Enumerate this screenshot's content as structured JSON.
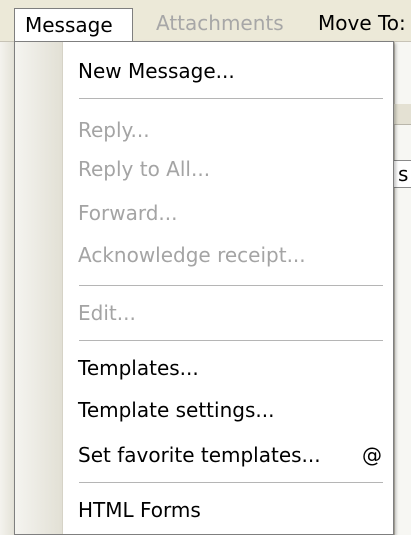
{
  "menubar": {
    "items": [
      {
        "label": "Message",
        "state": "open"
      },
      {
        "label": "Attachments",
        "state": "disabled"
      },
      {
        "label": "Move To:",
        "state": "normal"
      }
    ]
  },
  "background": {
    "field_text": "s"
  },
  "menu": {
    "items": [
      {
        "label": "New Message...",
        "enabled": true
      },
      {
        "label": "Reply...",
        "enabled": false
      },
      {
        "label": "Reply to All...",
        "enabled": false
      },
      {
        "label": "Forward...",
        "enabled": false
      },
      {
        "label": "Acknowledge receipt...",
        "enabled": false
      },
      {
        "label": "Edit...",
        "enabled": false
      },
      {
        "label": "Templates...",
        "enabled": true
      },
      {
        "label": "Template settings...",
        "enabled": true
      },
      {
        "label": "Set favorite templates...",
        "enabled": true,
        "shortcut": "@"
      },
      {
        "label": "HTML Forms",
        "enabled": true
      }
    ]
  }
}
